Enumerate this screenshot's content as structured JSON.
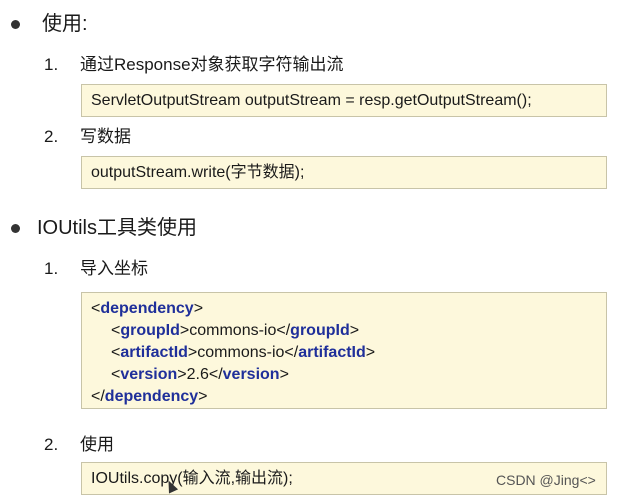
{
  "section1": {
    "title": "使用:",
    "steps": [
      {
        "num": "1.",
        "label": "通过Response对象获取字符输出流",
        "code": "ServletOutputStream outputStream = resp.getOutputStream();"
      },
      {
        "num": "2.",
        "label": "写数据",
        "code": "outputStream.write(字节数据);"
      }
    ]
  },
  "section2": {
    "title": "IOUtils工具类使用",
    "step1": {
      "num": "1.",
      "label": "导入坐标",
      "xml": {
        "lt": "<",
        "gt": ">",
        "lt_slash": "</",
        "dependency": "dependency",
        "groupId_tag": "groupId",
        "groupId_val": "commons-io",
        "artifactId_tag": "artifactId",
        "artifactId_val": "commons-io",
        "version_tag": "version",
        "version_val": "2.6"
      }
    },
    "step2": {
      "num": "2.",
      "label": "使用",
      "code": "IOUtils.copy(输入流,输出流);"
    }
  },
  "watermark": "CSDN @Jing<>"
}
